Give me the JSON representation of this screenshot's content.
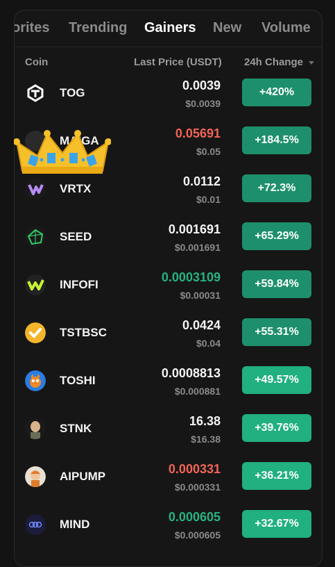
{
  "tabs": [
    "orites",
    "Trending",
    "Gainers",
    "New",
    "Volume"
  ],
  "header": {
    "coin": "Coin",
    "last_price": "Last Price (USDT)",
    "change": "24h Change"
  },
  "colors": {
    "up": "#27b383",
    "down": "#f26457",
    "neutral": "#f4f4f4",
    "pill_dim": "#1e8f6c",
    "pill_bright": "#21b07f"
  },
  "rows": [
    {
      "symbol": "TOG",
      "price": "0.0039",
      "usd": "$0.0039",
      "change": "+420%",
      "price_color": "neutral",
      "icon": "tog-icon"
    },
    {
      "symbol": "MAIGA",
      "price": "0.05691",
      "usd": "$0.05",
      "change": "+184.5%",
      "price_color": "down",
      "icon": "maiga-icon"
    },
    {
      "symbol": "VRTX",
      "price": "0.0112",
      "usd": "$0.01",
      "change": "+72.3%",
      "price_color": "neutral",
      "icon": "vrtx-icon"
    },
    {
      "symbol": "SEED",
      "price": "0.001691",
      "usd": "$0.001691",
      "change": "+65.29%",
      "price_color": "neutral",
      "icon": "seed-icon"
    },
    {
      "symbol": "INFOFI",
      "price": "0.0003109",
      "usd": "$0.00031",
      "change": "+59.84%",
      "price_color": "up",
      "icon": "infofi-icon"
    },
    {
      "symbol": "TSTBSC",
      "price": "0.0424",
      "usd": "$0.04",
      "change": "+55.31%",
      "price_color": "neutral",
      "icon": "tstbsc-icon"
    },
    {
      "symbol": "TOSHI",
      "price": "0.0008813",
      "usd": "$0.000881",
      "change": "+49.57%",
      "price_color": "neutral",
      "icon": "toshi-icon"
    },
    {
      "symbol": "STNK",
      "price": "16.38",
      "usd": "$16.38",
      "change": "+39.76%",
      "price_color": "neutral",
      "icon": "stnk-icon"
    },
    {
      "symbol": "AIPUMP",
      "price": "0.000331",
      "usd": "$0.000331",
      "change": "+36.21%",
      "price_color": "down",
      "icon": "aipump-icon"
    },
    {
      "symbol": "MIND",
      "price": "0.000605",
      "usd": "$0.000605",
      "change": "+32.67%",
      "price_color": "up",
      "icon": "mind-icon"
    }
  ]
}
